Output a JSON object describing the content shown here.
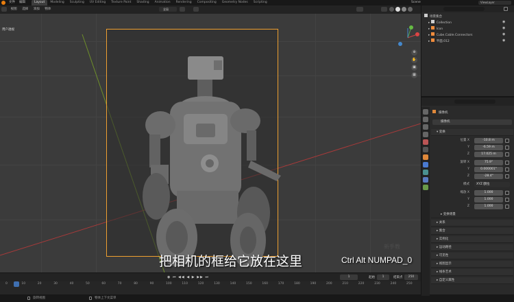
{
  "topbar": {
    "menus": [
      "文件",
      "编辑"
    ],
    "workspaces": [
      "Layout",
      "Modeling",
      "Sculpting",
      "UV Editing",
      "Texture Paint",
      "Shading",
      "Animation",
      "Rendering",
      "Compositing",
      "Geometry Nodes",
      "Scripting"
    ],
    "scene": "Scene",
    "view_layer": "ViewLayer"
  },
  "viewport_header": {
    "menus": [
      "视图",
      "选择",
      "添加",
      "物体"
    ],
    "transform": "全局"
  },
  "viewport": {
    "camera_label": "用户透视",
    "watermark": "新手教",
    "subtitle_cn": "把相机的框给它放在这里",
    "subtitle_en": "Ctrl Alt NUMPAD_0"
  },
  "outliner": {
    "title": "场景集合",
    "rows": [
      {
        "label": "Collection",
        "icon_color": "#d0d0d0"
      },
      {
        "label": "Icon",
        "icon_color": "#f08c3c"
      },
      {
        "label": "Cube.Cable.Connectors",
        "icon_color": "#f08c3c"
      },
      {
        "label": "平面.012",
        "icon_color": "#f08c3c"
      }
    ]
  },
  "properties": {
    "object_name": "摄像机",
    "data_name": "摄像机",
    "sections": {
      "transform": "变换",
      "delta": "变换增量",
      "relations": "关系",
      "collections": "集合",
      "instancing": "实例化",
      "motion_paths": "运动路径",
      "visibility": "可见性",
      "viewport_display": "视图显示",
      "line_art": "线条艺术",
      "custom_props": "自定义属性"
    },
    "location": [
      {
        "axis": "位置 X",
        "value": "-10.8 m"
      },
      {
        "axis": "Y",
        "value": "-6.59 m"
      },
      {
        "axis": "Z",
        "value": "17.025 m"
      }
    ],
    "rotation": [
      {
        "axis": "旋转 X",
        "value": "75.9°"
      },
      {
        "axis": "Y",
        "value": "0.000001°"
      },
      {
        "axis": "Z",
        "value": "-28.4°"
      }
    ],
    "mode_label": "模式",
    "mode_value": "XYZ 欧拉",
    "scale": [
      {
        "axis": "缩放 X",
        "value": "1.000"
      },
      {
        "axis": "Y",
        "value": "1.000"
      },
      {
        "axis": "Z",
        "value": "1.000"
      }
    ]
  },
  "timeline": {
    "current_frame": "1",
    "start_label": "起始",
    "start": "1",
    "end_label": "结束点",
    "end": "250",
    "ticks": [
      "0",
      "10",
      "20",
      "30",
      "40",
      "50",
      "60",
      "70",
      "80",
      "90",
      "100",
      "110",
      "120",
      "130",
      "140",
      "150",
      "160",
      "170",
      "180",
      "190",
      "200",
      "210",
      "220",
      "230",
      "240",
      "250"
    ]
  },
  "statusbar": {
    "left": "旋转视图",
    "middle": "物体上下文菜单"
  },
  "colors": {
    "camera_frame": "#f0a030",
    "axis_red": "#a83a3a",
    "axis_green": "#6e8f2a"
  }
}
